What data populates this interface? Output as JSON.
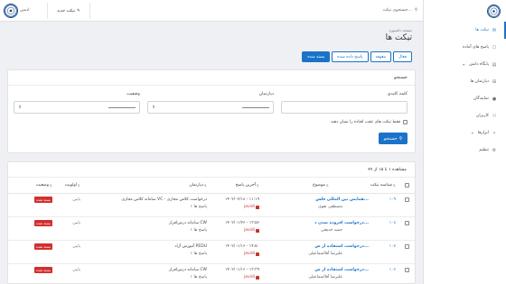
{
  "topbar": {
    "user_label": "ادمین",
    "new_ticket_label": "تیکت جدید",
    "search_placeholder": "جستجوی تیکت..."
  },
  "sidebar": {
    "items": [
      {
        "label": "تیکت ها",
        "icon": "ticket-icon"
      },
      {
        "label": "پاسخ های آماده",
        "icon": "comment-icon"
      },
      {
        "label": "پایگاه دانش",
        "icon": "book-icon"
      },
      {
        "label": "دپارتمان ها",
        "icon": "sitemap-icon"
      },
      {
        "label": "نمایندگان",
        "icon": "user-icon"
      },
      {
        "label": "کاربران",
        "icon": "users-icon"
      },
      {
        "label": "ابزارها",
        "icon": "wrench-icon"
      },
      {
        "label": "تنظیم",
        "icon": "gear-icon"
      }
    ]
  },
  "page": {
    "breadcrumb": "صفحه داشبورد",
    "title": "تیکت ها",
    "tabs": [
      "فعال",
      "معوقه",
      "پاسخ داده شده",
      "بسته شده"
    ],
    "active_tab": "بسته شده"
  },
  "search": {
    "header": "جستجو",
    "keyword_label": "کلمه کلیدی",
    "department_label": "دپارتمان",
    "status_label": "وضعیت",
    "department_value": "----------",
    "status_value": "----------",
    "overdue_label": "فقط تیکت های عقب افتاده را نشان دهید",
    "button_label": "جستجو"
  },
  "table": {
    "info": "مشاهده ۱ تا ۱۵ از ۷۷",
    "headers": {
      "number": "شناسه تیکت",
      "subject": "موضوع",
      "last_reply": "آخرین پاسخ",
      "department": "دپارتمان",
      "priority": "اولویت",
      "status": "وضعیت"
    },
    "rows": [
      {
        "number": "۱۰۹",
        "subject": "همایش بین المللی فلس...",
        "author": "مصطفی تقوی",
        "last_reply": "۱۴۰۲/۰۲/۱۸ - ۱۱:۱۹",
        "last_user": "javidi",
        "department": "سامانه کلاس مجازی VC - درخواست کلاس مجازی",
        "replies": "۱ پاسخ ها",
        "priority": "پایین",
        "status": "بسته شده"
      },
      {
        "number": "۱۰۸",
        "subject": "درخواست افزوده شدن د...",
        "author": "حمید جدیعتی",
        "last_reply": "۱۴۰۲/۰۱/۲۶ - ۱۳:۵۶",
        "last_user": "javidi",
        "department": "سامانه درس‌افزار CW",
        "replies": "۱ پاسخ ها",
        "priority": "پایین",
        "status": "بسته شده"
      },
      {
        "number": "۱۰۷",
        "subject": "درخواست استفاده از س...",
        "author": "علیرضا آقااسماعیلی",
        "last_reply": "۱۴۰۲/۰۱/۱۶ - ۱۴:۵۰",
        "last_user": "javidi",
        "department": "آموزش آزاد PEDU",
        "replies": "۱ پاسخ ها",
        "priority": "پایین",
        "status": "بسته شده"
      },
      {
        "number": "۱۰۶",
        "subject": "درخواست استفاده از س...",
        "author": "علیرضا آقااسماعیلی",
        "last_reply": "۱۴۰۲/۰۱/۱۶ - ۱۳:۳۹",
        "last_user": "javidi",
        "department": "سامانه درس‌افزار CW",
        "replies": "۱ پاسخ ها",
        "priority": "پایین",
        "status": "بسته شده"
      }
    ]
  },
  "colors": {
    "accent": "#1a73c8",
    "closed_badge": "#d32f2f",
    "user_red": "#c0392b",
    "background": "#eef0f3"
  }
}
